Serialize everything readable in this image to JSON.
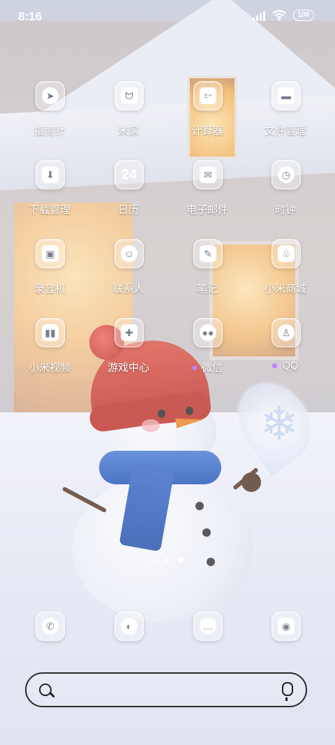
{
  "status_bar": {
    "time": "8:16",
    "battery": "100",
    "signal_bars": 4,
    "wifi": "wifi-icon"
  },
  "apps": [
    {
      "label": "指南针",
      "icon": "compass-icon"
    },
    {
      "label": "米家",
      "icon": "mijia-icon"
    },
    {
      "label": "计算器",
      "icon": "calculator-icon"
    },
    {
      "label": "文件管理",
      "icon": "folder-icon"
    },
    {
      "label": "下载管理",
      "icon": "download-icon"
    },
    {
      "label": "日历",
      "icon": "calendar-icon",
      "glyph": "24"
    },
    {
      "label": "电子邮件",
      "icon": "mail-icon"
    },
    {
      "label": "时钟",
      "icon": "clock-icon"
    },
    {
      "label": "录音机",
      "icon": "recorder-icon"
    },
    {
      "label": "联系人",
      "icon": "contacts-icon"
    },
    {
      "label": "笔记",
      "icon": "notes-icon"
    },
    {
      "label": "小米商城",
      "icon": "shopping-bag-icon"
    },
    {
      "label": "小米视频",
      "icon": "video-icon"
    },
    {
      "label": "游戏中心",
      "icon": "gamepad-icon"
    },
    {
      "label": "微信",
      "icon": "wechat-icon",
      "notify": true
    },
    {
      "label": "QQ",
      "icon": "qq-icon",
      "notify": true
    }
  ],
  "dock": [
    {
      "icon": "phone-icon"
    },
    {
      "icon": "browser-icon"
    },
    {
      "icon": "messages-icon"
    },
    {
      "icon": "camera-icon"
    }
  ],
  "pager": {
    "pages": 2,
    "active": 2
  },
  "search": {
    "placeholder": ""
  },
  "colors": {
    "notify_dot": "#b884ff",
    "label": "#ffffff"
  }
}
